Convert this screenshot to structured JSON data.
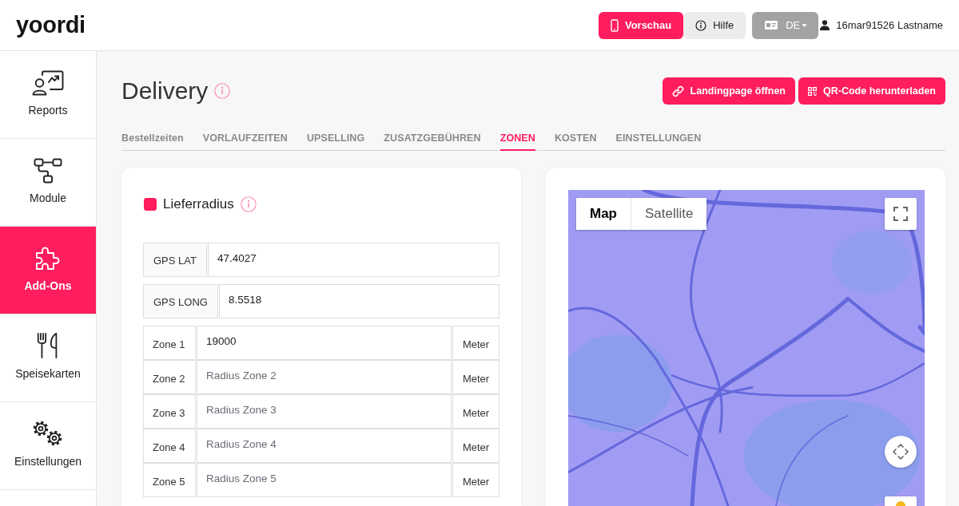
{
  "header": {
    "logo": "yoordi",
    "buttons": [
      {
        "kind": "preview",
        "label": "Vorschau"
      },
      {
        "kind": "help",
        "label": "Hilfe"
      },
      {
        "kind": "language",
        "label": "DE"
      }
    ],
    "user": "16mar91526 Lastname"
  },
  "sidebar": {
    "items": [
      {
        "label": "Reports",
        "selected": false
      },
      {
        "label": "Module",
        "selected": false
      },
      {
        "label": "Add-Ons",
        "selected": true
      },
      {
        "label": "Speisekarten",
        "selected": false
      },
      {
        "label": "Einstellungen",
        "selected": false
      }
    ]
  },
  "page": {
    "title": "Delivery",
    "actions": [
      {
        "label": "Landingpage öffnen"
      },
      {
        "label": "QR-Code herunterladen"
      }
    ]
  },
  "tabs": [
    {
      "label": "Bestellzeiten",
      "selected": false
    },
    {
      "label": "VORLAUFZEITEN",
      "selected": false
    },
    {
      "label": "UPSELLING",
      "selected": false
    },
    {
      "label": "ZUSATZGEBÜHREN",
      "selected": false
    },
    {
      "label": "ZONEN",
      "selected": true
    },
    {
      "label": "KOSTEN",
      "selected": false
    },
    {
      "label": "EINSTELLUNGEN",
      "selected": false
    }
  ],
  "zone_card": {
    "title": "Lieferradius",
    "checked": true,
    "gps": [
      {
        "label": "GPS LAT",
        "value": "47.4027"
      },
      {
        "label": "GPS LONG",
        "value": "8.5518"
      }
    ],
    "zones": [
      {
        "label": "Zone 1",
        "value": "19000",
        "unit": "Meter"
      },
      {
        "label": "Zone 2",
        "placeholder": "Radius Zone 2",
        "unit": "Meter"
      },
      {
        "label": "Zone 3",
        "placeholder": "Radius Zone 3",
        "unit": "Meter"
      },
      {
        "label": "Zone 4",
        "placeholder": "Radius Zone 4",
        "unit": "Meter"
      },
      {
        "label": "Zone 5",
        "placeholder": "Radius Zone 5",
        "unit": "Meter"
      }
    ]
  },
  "map": {
    "types": [
      {
        "label": "Map",
        "selected": true
      },
      {
        "label": "Satellite",
        "selected": false
      }
    ]
  }
}
